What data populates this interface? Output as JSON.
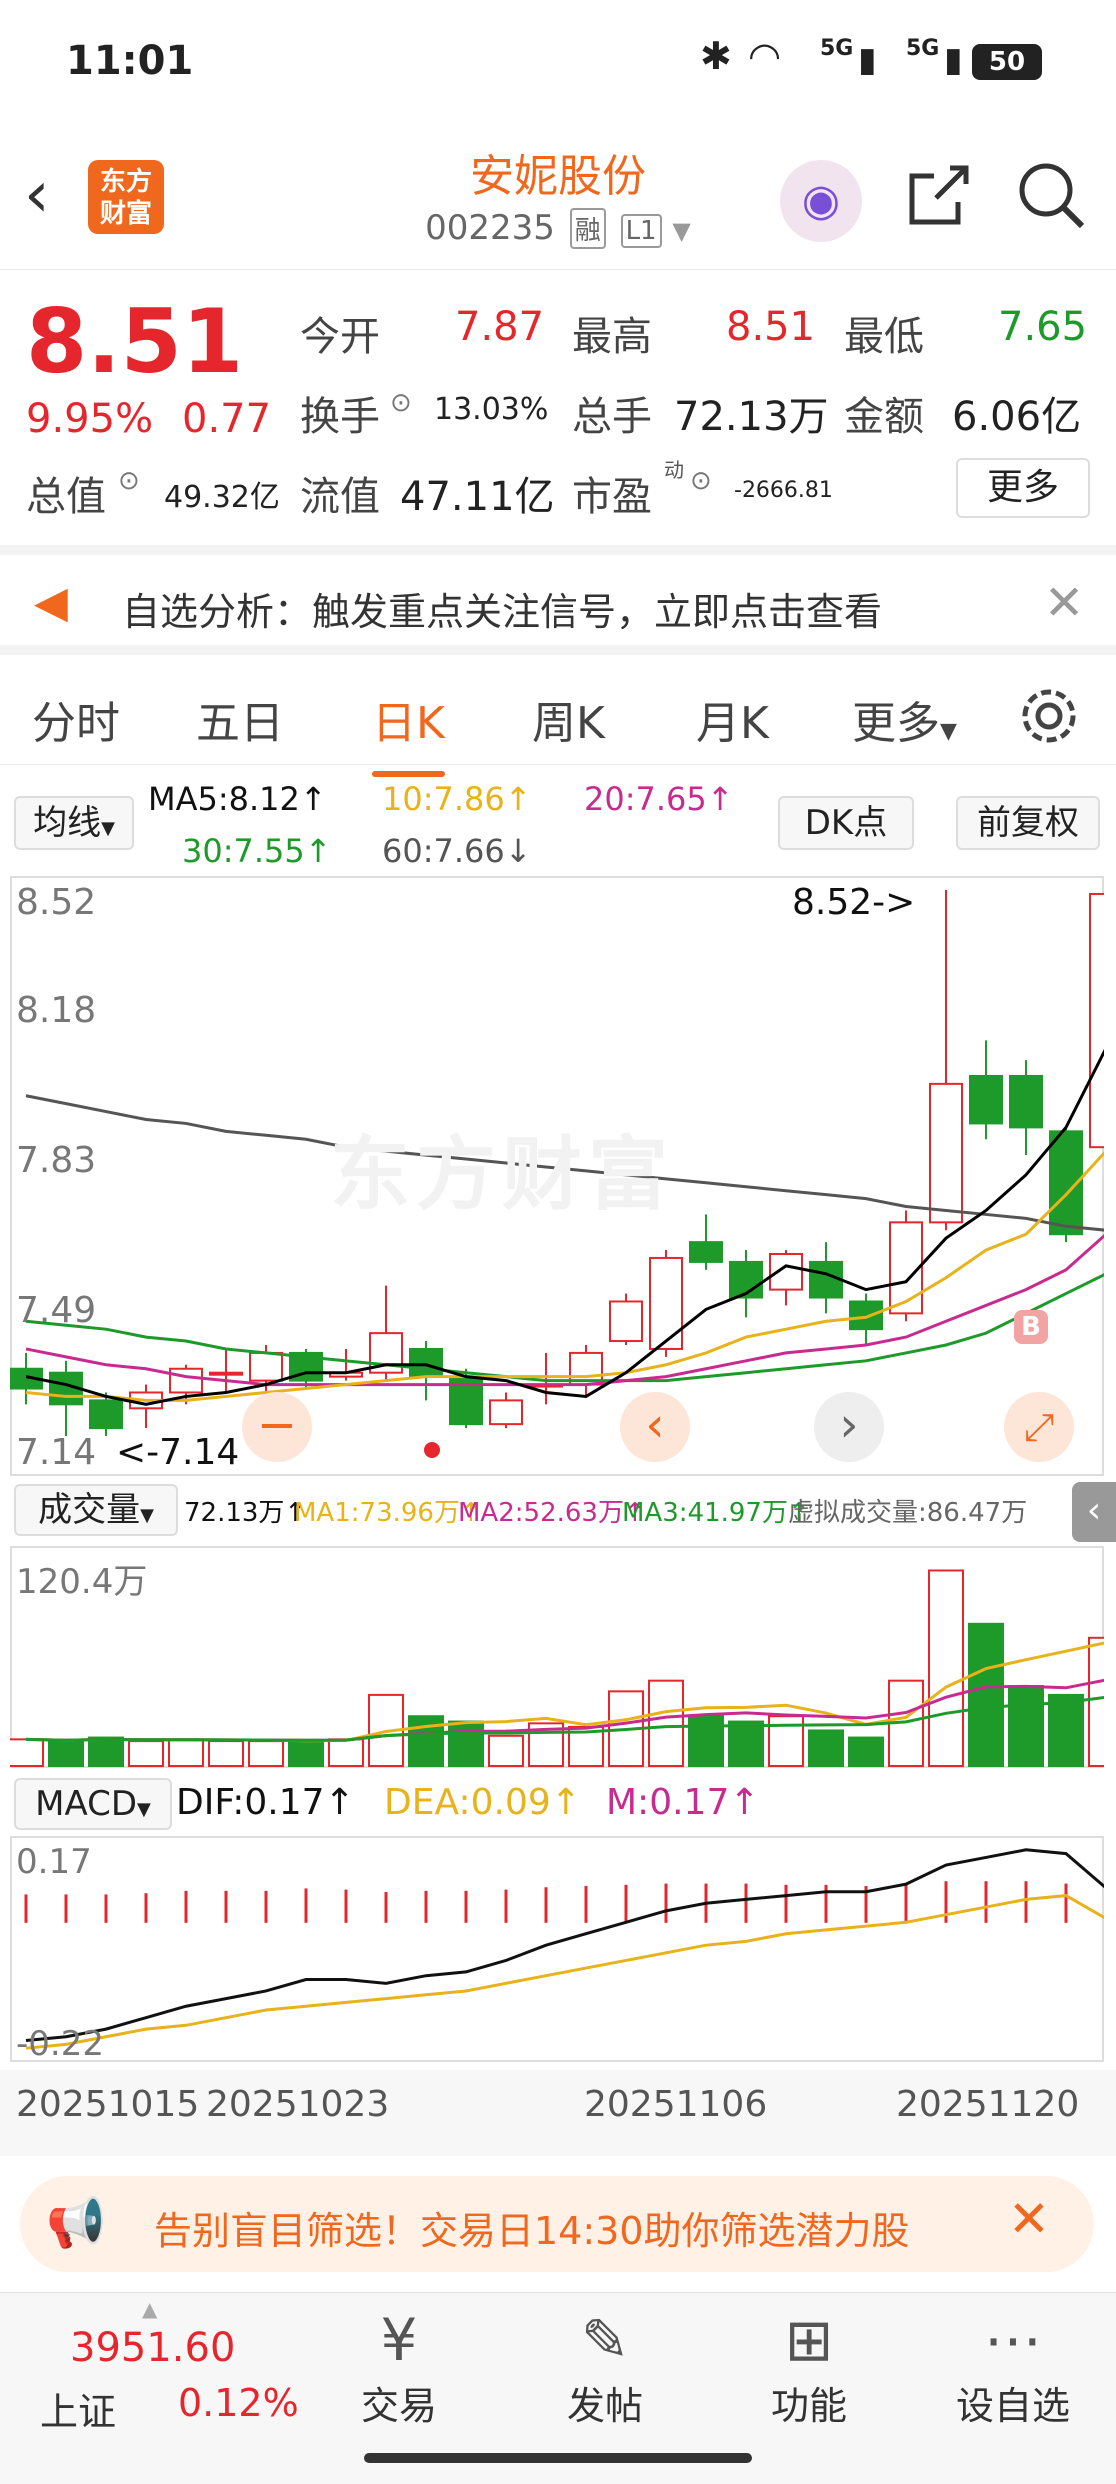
{
  "status": {
    "time": "11:01",
    "battery": "50",
    "net1": "5G",
    "net2": "5G"
  },
  "header": {
    "title": "安妮股份",
    "code": "002235",
    "tag1": "融",
    "tag2": "L1",
    "logo": "东方财富"
  },
  "quote": {
    "price": "8.51",
    "pct": "9.95%",
    "change": "0.77",
    "labels": {
      "open": "今开",
      "high": "最高",
      "low": "最低",
      "turnover": "换手",
      "volume": "总手",
      "amount": "金额",
      "mktcap": "总值",
      "float": "流值",
      "pe": "市盈",
      "pe_sup": "动"
    },
    "values": {
      "open": "7.87",
      "high": "8.51",
      "low": "7.65",
      "turnover": "13.03%",
      "volume": "72.13万",
      "amount": "6.06亿",
      "mktcap": "49.32亿",
      "float": "47.11亿",
      "pe": "-2666.81"
    },
    "more": "更多"
  },
  "banner": {
    "text": "自选分析：触发重点关注信号，立即点击查看"
  },
  "tabs": [
    "分时",
    "五日",
    "日K",
    "周K",
    "月K",
    "更多"
  ],
  "ma_bar": {
    "selector": "均线",
    "ma5": "MA5:8.12↑",
    "ma10": "10:7.86↑",
    "ma20": "20:7.65↑",
    "ma30": "30:7.55↑",
    "ma60": "60:7.66↓",
    "dk": "DK点",
    "adj": "前复权"
  },
  "price_chart": {
    "y_labels": [
      "8.52",
      "8.18",
      "7.83",
      "7.49",
      "7.14"
    ],
    "max_label": "8.52->",
    "min_label": "<-7.14",
    "watermark": "东方财富",
    "b_marker": "B"
  },
  "volume_bar": {
    "selector": "成交量",
    "vol": "72.13万↑",
    "ma1": "MA1:73.96万↑",
    "ma2": "MA2:52.63万↑",
    "ma3": "MA3:41.97万↑",
    "virtual": "虚拟成交量:86.47万",
    "y_label": "120.4万"
  },
  "macd_bar": {
    "selector": "MACD",
    "dif": "DIF:0.17↑",
    "dea": "DEA:0.09↑",
    "m": "M:0.17↑",
    "y_top": "0.17",
    "y_bottom": "-0.22"
  },
  "dates": [
    "20251015",
    "20251023",
    "20251106",
    "20251120"
  ],
  "ad": {
    "text": "告别盲目筛选！交易日14:30助你筛选潜力股"
  },
  "nav": {
    "index_value": "3951.60",
    "index_name": "上证",
    "index_pct": "0.12%",
    "items": [
      "交易",
      "发帖",
      "功能",
      "设自选"
    ]
  },
  "colors": {
    "up": "#e5262c",
    "down": "#1d9a2a",
    "accent": "#f0671e",
    "ma5": "#000000",
    "ma10": "#e8b21a",
    "ma20": "#c72b8f",
    "ma30": "#1d9a2a",
    "ma60": "#555555"
  },
  "chart_data": {
    "type": "candlestick",
    "dates": [
      "20251015",
      "20251016",
      "20251017",
      "20251020",
      "20251021",
      "20251022",
      "20251023",
      "20251024",
      "20251027",
      "20251028",
      "20251029",
      "20251030",
      "20251031",
      "20251103",
      "20251104",
      "20251105",
      "20251106",
      "20251107",
      "20251110",
      "20251111",
      "20251112",
      "20251113",
      "20251114",
      "20251117",
      "20251118",
      "20251119",
      "20251120",
      "20251121"
    ],
    "candles": [
      {
        "o": 7.31,
        "c": 7.26,
        "h": 7.35,
        "l": 7.22
      },
      {
        "o": 7.3,
        "c": 7.22,
        "h": 7.33,
        "l": 7.14
      },
      {
        "o": 7.23,
        "c": 7.16,
        "h": 7.25,
        "l": 7.14
      },
      {
        "o": 7.21,
        "c": 7.25,
        "h": 7.27,
        "l": 7.16
      },
      {
        "o": 7.25,
        "c": 7.31,
        "h": 7.32,
        "l": 7.22
      },
      {
        "o": 7.3,
        "c": 7.3,
        "h": 7.36,
        "l": 7.25
      },
      {
        "o": 7.28,
        "c": 7.35,
        "h": 7.37,
        "l": 7.24
      },
      {
        "o": 7.35,
        "c": 7.28,
        "h": 7.36,
        "l": 7.26
      },
      {
        "o": 7.29,
        "c": 7.3,
        "h": 7.36,
        "l": 7.28
      },
      {
        "o": 7.3,
        "c": 7.4,
        "h": 7.52,
        "l": 7.28
      },
      {
        "o": 7.36,
        "c": 7.29,
        "h": 7.38,
        "l": 7.23
      },
      {
        "o": 7.29,
        "c": 7.17,
        "h": 7.31,
        "l": 7.16
      },
      {
        "o": 7.17,
        "c": 7.23,
        "h": 7.25,
        "l": 7.16
      },
      {
        "o": 7.27,
        "c": 7.27,
        "h": 7.35,
        "l": 7.22
      },
      {
        "o": 7.27,
        "c": 7.35,
        "h": 7.37,
        "l": 7.24
      },
      {
        "o": 7.38,
        "c": 7.48,
        "h": 7.5,
        "l": 7.37
      },
      {
        "o": 7.36,
        "c": 7.59,
        "h": 7.61,
        "l": 7.34
      },
      {
        "o": 7.63,
        "c": 7.58,
        "h": 7.7,
        "l": 7.56
      },
      {
        "o": 7.58,
        "c": 7.49,
        "h": 7.61,
        "l": 7.44
      },
      {
        "o": 7.51,
        "c": 7.6,
        "h": 7.61,
        "l": 7.47
      },
      {
        "o": 7.58,
        "c": 7.49,
        "h": 7.63,
        "l": 7.45
      },
      {
        "o": 7.48,
        "c": 7.41,
        "h": 7.5,
        "l": 7.37
      },
      {
        "o": 7.45,
        "c": 7.68,
        "h": 7.71,
        "l": 7.43
      },
      {
        "o": 7.68,
        "c": 8.03,
        "h": 8.52,
        "l": 7.66
      },
      {
        "o": 8.05,
        "c": 7.93,
        "h": 8.14,
        "l": 7.89
      },
      {
        "o": 8.05,
        "c": 7.92,
        "h": 8.09,
        "l": 7.85
      },
      {
        "o": 7.91,
        "c": 7.65,
        "h": 7.92,
        "l": 7.63
      },
      {
        "o": 7.87,
        "c": 8.51,
        "h": 8.51,
        "l": 7.65
      }
    ],
    "ma5": [
      7.29,
      7.27,
      7.24,
      7.22,
      7.24,
      7.25,
      7.27,
      7.3,
      7.3,
      7.32,
      7.32,
      7.29,
      7.28,
      7.25,
      7.24,
      7.3,
      7.38,
      7.46,
      7.5,
      7.57,
      7.55,
      7.51,
      7.53,
      7.64,
      7.71,
      7.8,
      7.92,
      8.12
    ],
    "ma10": [
      7.25,
      7.24,
      7.24,
      7.23,
      7.23,
      7.24,
      7.25,
      7.26,
      7.27,
      7.28,
      7.29,
      7.29,
      7.29,
      7.29,
      7.29,
      7.3,
      7.32,
      7.35,
      7.39,
      7.41,
      7.43,
      7.44,
      7.48,
      7.54,
      7.61,
      7.65,
      7.75,
      7.86
    ],
    "ma20": [
      7.36,
      7.34,
      7.32,
      7.31,
      7.29,
      7.28,
      7.27,
      7.27,
      7.27,
      7.27,
      7.27,
      7.27,
      7.27,
      7.27,
      7.27,
      7.28,
      7.29,
      7.31,
      7.33,
      7.35,
      7.36,
      7.37,
      7.39,
      7.43,
      7.47,
      7.51,
      7.56,
      7.65
    ],
    "ma30": [
      7.43,
      7.42,
      7.41,
      7.39,
      7.38,
      7.36,
      7.35,
      7.34,
      7.33,
      7.32,
      7.31,
      7.3,
      7.29,
      7.28,
      7.28,
      7.28,
      7.28,
      7.29,
      7.3,
      7.31,
      7.32,
      7.33,
      7.35,
      7.37,
      7.4,
      7.45,
      7.5,
      7.55
    ],
    "ma60": [
      8.0,
      7.98,
      7.96,
      7.94,
      7.93,
      7.91,
      7.9,
      7.89,
      7.87,
      7.86,
      7.85,
      7.84,
      7.83,
      7.82,
      7.81,
      7.8,
      7.79,
      7.78,
      7.77,
      7.76,
      7.75,
      7.74,
      7.72,
      7.71,
      7.7,
      7.69,
      7.67,
      7.66
    ],
    "volume": [
      15,
      14,
      16,
      14,
      15,
      14,
      14,
      14,
      15,
      40,
      28,
      25,
      17,
      24,
      22,
      42,
      48,
      28,
      25,
      28,
      20,
      16,
      48,
      110,
      80,
      45,
      40,
      72.13
    ],
    "vol_up": [
      true,
      false,
      false,
      true,
      true,
      true,
      true,
      false,
      true,
      true,
      false,
      false,
      true,
      true,
      true,
      true,
      true,
      false,
      false,
      true,
      false,
      false,
      true,
      true,
      false,
      false,
      false,
      true
    ],
    "vol_ylim": [
      0,
      120.4
    ],
    "macd_dif": [
      -0.23,
      -0.22,
      -0.2,
      -0.17,
      -0.14,
      -0.12,
      -0.1,
      -0.07,
      -0.07,
      -0.08,
      -0.06,
      -0.05,
      -0.02,
      0.02,
      0.05,
      0.08,
      0.11,
      0.13,
      0.14,
      0.15,
      0.16,
      0.16,
      0.18,
      0.23,
      0.25,
      0.27,
      0.26,
      0.17
    ],
    "macd_dea": [
      -0.25,
      -0.24,
      -0.22,
      -0.2,
      -0.19,
      -0.17,
      -0.15,
      -0.14,
      -0.13,
      -0.12,
      -0.11,
      -0.1,
      -0.08,
      -0.06,
      -0.04,
      -0.02,
      0.0,
      0.02,
      0.03,
      0.05,
      0.06,
      0.07,
      0.08,
      0.1,
      0.12,
      0.14,
      0.15,
      0.09
    ],
    "macd_ylim": [
      -0.22,
      0.17
    ],
    "price_ylim": [
      7.14,
      8.52
    ]
  }
}
